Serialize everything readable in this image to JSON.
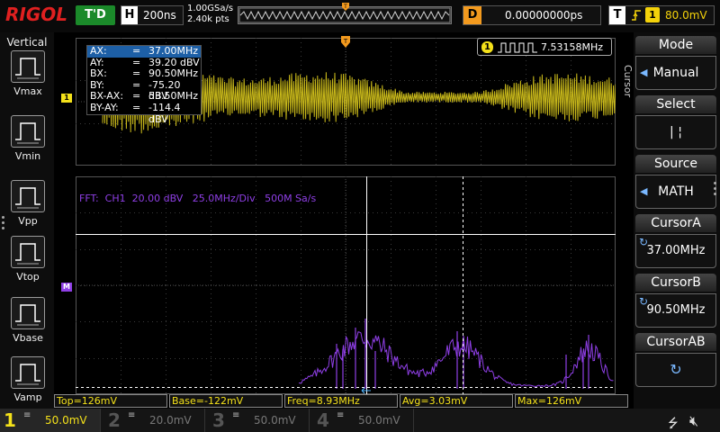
{
  "brand": "RIGOL",
  "top": {
    "trigger_status": "T'D",
    "timebase_label": "H",
    "timebase_value": "200ns",
    "sample_rate": "1.00GSa/s",
    "memory_depth": "2.40k pts",
    "delay_label": "D",
    "delay_value": "0.00000000ps",
    "trigger_label": "T",
    "trigger_source": "1",
    "trigger_level": "80.0mV",
    "trigger_edge_icon": "rising-edge-icon"
  },
  "left_panel": {
    "title": "Vertical",
    "items": [
      {
        "label": "Vmax",
        "icon": "vmax-icon"
      },
      {
        "label": "Vmin",
        "icon": "vmin-icon"
      },
      {
        "label": "Vpp",
        "icon": "vpp-icon"
      },
      {
        "label": "Vtop",
        "icon": "vtop-icon"
      },
      {
        "label": "Vbase",
        "icon": "vbase-icon"
      },
      {
        "label": "Vamp",
        "icon": "vamp-icon"
      }
    ]
  },
  "right_panel": {
    "vertical_label": "Cursor",
    "buttons": [
      {
        "title": "Mode",
        "value": "Manual",
        "indicator": "arrow"
      },
      {
        "title": "Select",
        "value": "| ¦",
        "indicator": "none"
      },
      {
        "title": "Source",
        "value": "MATH",
        "indicator": "arrow"
      },
      {
        "title": "CursorA",
        "value": "37.00MHz",
        "indicator": "knob"
      },
      {
        "title": "CursorB",
        "value": "90.50MHz",
        "indicator": "knob"
      },
      {
        "title": "CursorAB",
        "value": "",
        "indicator": "knob-center"
      }
    ]
  },
  "cursor_readout": [
    {
      "key": "AX:",
      "eq": "=",
      "value": "37.00MHz"
    },
    {
      "key": "AY:",
      "eq": "=",
      "value": "39.20 dBV"
    },
    {
      "key": "BX:",
      "eq": "=",
      "value": "90.50MHz"
    },
    {
      "key": "BY:",
      "eq": "=",
      "value": "-75.20 dBV"
    },
    {
      "key": "BX-AX:",
      "eq": "=",
      "value": "53.50MHz"
    },
    {
      "key": "BY-AY:",
      "eq": "=",
      "value": "-114.4 dBV"
    }
  ],
  "frequency_counter": {
    "channel": "1",
    "value": "7.53158MHz"
  },
  "fft_label": "FFT:  CH1  20.00 dBV   25.0MHz/Div   500M Sa/s",
  "markers": {
    "ch1": "1",
    "math": "M"
  },
  "results": [
    {
      "text": "Top=126mV"
    },
    {
      "text": "Base=-122mV"
    },
    {
      "text": "Freq=8.93MHz"
    },
    {
      "text": "Avg=3.03mV"
    },
    {
      "text": "Max=126mV"
    }
  ],
  "channels": [
    {
      "num": "1",
      "coupling": "≡",
      "scale": "50.0mV",
      "color": "#f4e11a",
      "active": true
    },
    {
      "num": "2",
      "coupling": "≡",
      "scale": "20.0mV",
      "color": "#1fb3a8",
      "active": false
    },
    {
      "num": "3",
      "coupling": "≡",
      "scale": "50.0mV",
      "color": "#c23fb6",
      "active": false
    },
    {
      "num": "4",
      "coupling": "≡",
      "scale": "50.0mV",
      "color": "#2c6fd6",
      "active": false
    }
  ],
  "colors": {
    "ch1": "#c8b81a",
    "math": "#8f3fe6",
    "grid": "#555555",
    "accent_orange": "#f39a1e"
  }
}
